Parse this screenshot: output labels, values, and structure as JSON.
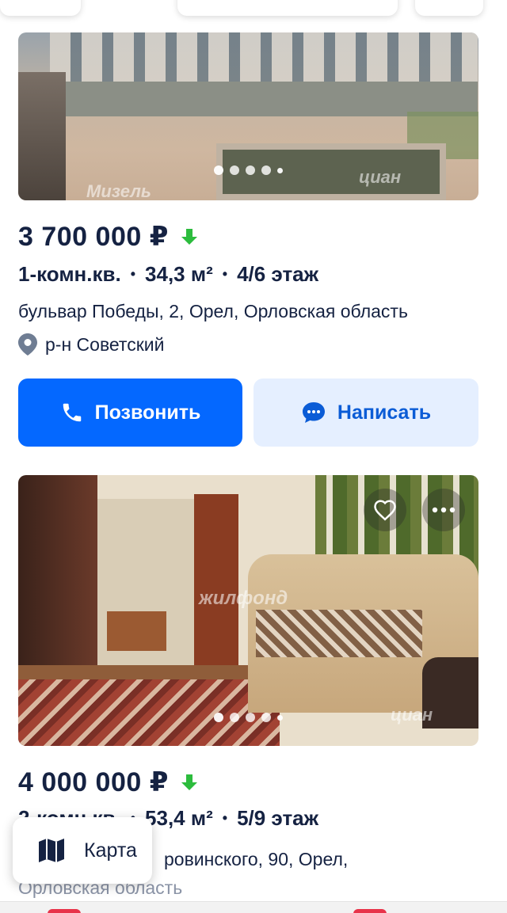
{
  "listings": [
    {
      "photo": {
        "watermark": "Мизель",
        "watermark2": "циан",
        "dots_total": 5,
        "dots_active": 1
      },
      "price": "3 700 000 ₽",
      "price_trend_icon": "arrow-down-icon",
      "rooms": "1-комн.кв.",
      "area": "34,3 м²",
      "floor": "4/6 этаж",
      "address": "бульвар Победы, 2, Орел, Орловская область",
      "district": "р-н Советский",
      "call_label": "Позвонить",
      "message_label": "Написать"
    },
    {
      "photo": {
        "watermark": "жилфонд",
        "watermark2": "циан",
        "dots_total": 5,
        "dots_active": 1
      },
      "price": "4 000 000 ₽",
      "price_trend_icon": "arrow-down-icon",
      "rooms": "2-комн.кв.",
      "area": "53,4 м²",
      "floor": "5/9 этаж",
      "address_visible": "ровинского, 90, Орел,",
      "address_line2": "Орловская область"
    }
  ],
  "map_button": {
    "label": "Карта",
    "icon": "map-icon"
  },
  "colors": {
    "primary": "#0468ff",
    "primary_light": "#e5efff",
    "text": "#152242",
    "trend_down": "#2cbc3d"
  }
}
